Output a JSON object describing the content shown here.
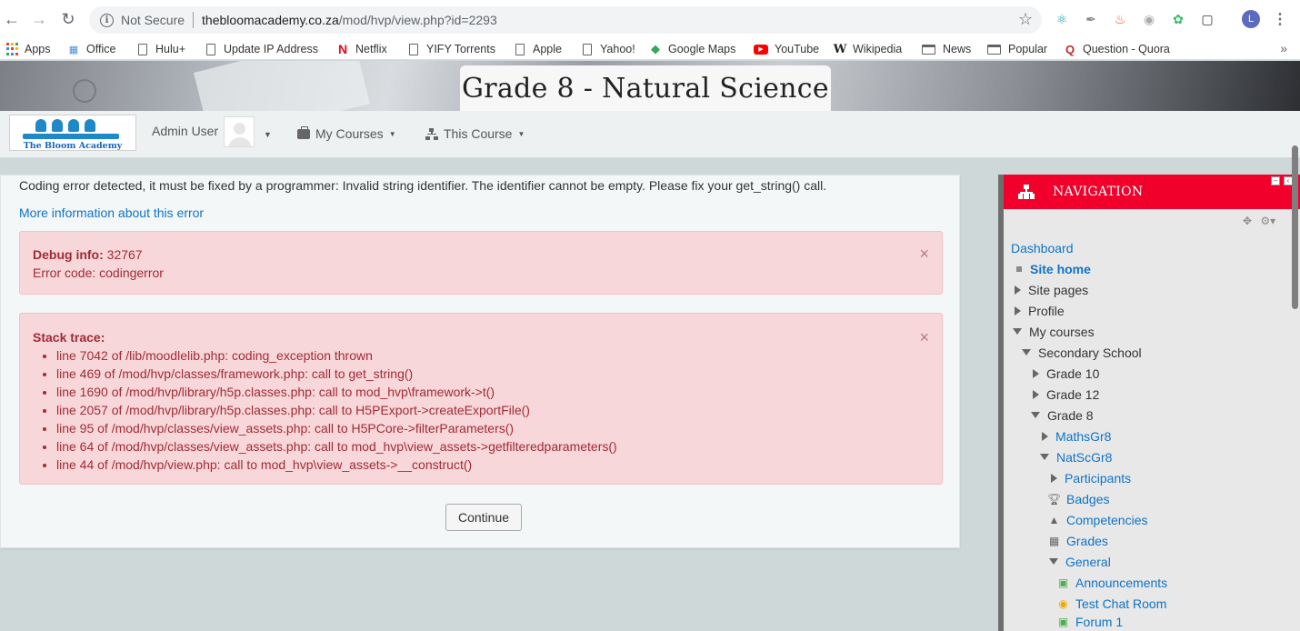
{
  "browser": {
    "not_secure": "Not Secure",
    "url_host": "thebloomacademy.co.za",
    "url_path": "/mod/hvp/view.php?id=2293",
    "profile_initial": "L"
  },
  "bookmarks": [
    {
      "label": "Apps"
    },
    {
      "label": "Office"
    },
    {
      "label": "Hulu+"
    },
    {
      "label": "Update IP Address"
    },
    {
      "label": "Netflix"
    },
    {
      "label": "YIFY Torrents"
    },
    {
      "label": "Apple"
    },
    {
      "label": "Yahoo!"
    },
    {
      "label": "Google Maps"
    },
    {
      "label": "YouTube"
    },
    {
      "label": "Wikipedia"
    },
    {
      "label": "News"
    },
    {
      "label": "Popular"
    },
    {
      "label": "Question - Quora"
    }
  ],
  "header": {
    "course_title": "Grade 8 - Natural Science",
    "logo_text": "The Bloom Academy",
    "user_name": "Admin User",
    "my_courses": "My Courses",
    "this_course": "This Course"
  },
  "error": {
    "message": "Coding error detected, it must be fixed by a programmer: Invalid string identifier. The identifier cannot be empty. Please fix your get_string() call.",
    "more_info": "More information about this error",
    "debug_label": "Debug info:",
    "debug_value": "32767",
    "error_code": "Error code: codingerror",
    "trace_label": "Stack trace:",
    "trace": [
      "line 7042 of /lib/moodlelib.php: coding_exception thrown",
      "line 469 of /mod/hvp/classes/framework.php: call to get_string()",
      "line 1690 of /mod/hvp/library/h5p.classes.php: call to mod_hvp\\framework->t()",
      "line 2057 of /mod/hvp/library/h5p.classes.php: call to H5PExport->createExportFile()",
      "line 95 of /mod/hvp/classes/view_assets.php: call to H5PCore->filterParameters()",
      "line 64 of /mod/hvp/classes/view_assets.php: call to mod_hvp\\view_assets->getfilteredparameters()",
      "line 44 of /mod/hvp/view.php: call to mod_hvp\\view_assets->__construct()"
    ],
    "continue_label": "Continue"
  },
  "navigation": {
    "title": "NAVIGATION",
    "items": [
      {
        "label": "Dashboard"
      },
      {
        "label": "Site home"
      },
      {
        "label": "Site pages"
      },
      {
        "label": "Profile"
      },
      {
        "label": "My courses"
      },
      {
        "label": "Secondary School"
      },
      {
        "label": "Grade 10"
      },
      {
        "label": "Grade 12"
      },
      {
        "label": "Grade 8"
      },
      {
        "label": "MathsGr8"
      },
      {
        "label": "NatScGr8"
      },
      {
        "label": "Participants"
      },
      {
        "label": "Badges"
      },
      {
        "label": "Competencies"
      },
      {
        "label": "Grades"
      },
      {
        "label": "General"
      },
      {
        "label": "Announcements"
      },
      {
        "label": "Test Chat Room"
      },
      {
        "label": "Forum 1"
      }
    ]
  },
  "colors": {
    "nav_header": "#f0002a",
    "link": "#0f73c7",
    "alert_bg": "#f7d7d9",
    "alert_text": "#a22b35"
  }
}
